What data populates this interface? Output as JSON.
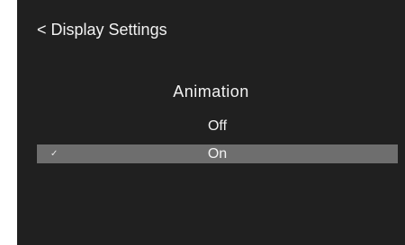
{
  "header": {
    "back_glyph": "<",
    "title": "Display Settings"
  },
  "section": {
    "title": "Animation"
  },
  "options": [
    {
      "label": "Off",
      "selected": false
    },
    {
      "label": "On",
      "selected": true,
      "check_glyph": "✓"
    }
  ],
  "colors": {
    "background": "#202020",
    "selected_row": "#6e6e6e",
    "text": "#f2f2f2"
  }
}
